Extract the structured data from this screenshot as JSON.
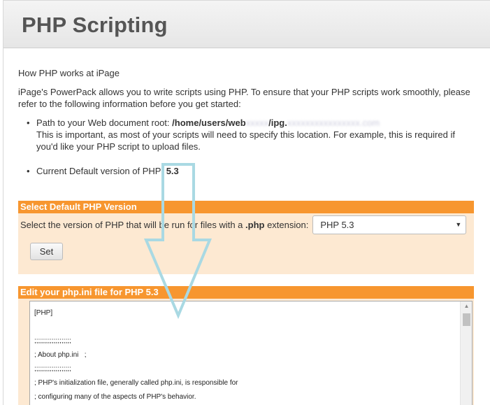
{
  "header": {
    "title": "PHP Scripting"
  },
  "intro": {
    "heading": "How PHP works at iPage",
    "text": "iPage's PowerPack allows you to write scripts using PHP. To ensure that your PHP scripts work smoothly, please refer to the following information before you get started:"
  },
  "info": {
    "docroot_label": "Path to your Web document root: ",
    "docroot_value_a": "/home/users/web",
    "docroot_value_b": "/ipg.",
    "docroot_note": "This is important, as most of your scripts will need to specify this location. For example, this is required if you'd like your PHP script to upload files.",
    "version_label": "Current Default version of PHP: ",
    "version_value": "5.3"
  },
  "select_section": {
    "header": "Select Default PHP Version",
    "label_prefix": "Select the version of PHP that will be run for files with a ",
    "label_ext": ".php",
    "label_suffix": " extension:",
    "selected_option": "PHP 5.3",
    "set_button": "Set"
  },
  "ini_section": {
    "header": "Edit your php.ini file for PHP 5.3",
    "lines": [
      "[PHP]",
      "",
      ";;;;;;;;;;;;;;;;;;;",
      "; About php.ini   ;",
      ";;;;;;;;;;;;;;;;;;;",
      "; PHP's initialization file, generally called php.ini, is responsible for",
      "; configuring many of the aspects of PHP's behavior."
    ]
  },
  "colors": {
    "section_header": "#f7962f",
    "section_body": "#fde9d2",
    "annotation_arrow": "#a9d9e3"
  },
  "icons": {
    "select_caret": "chevron-down-icon",
    "annotation": "down-arrow-icon"
  }
}
